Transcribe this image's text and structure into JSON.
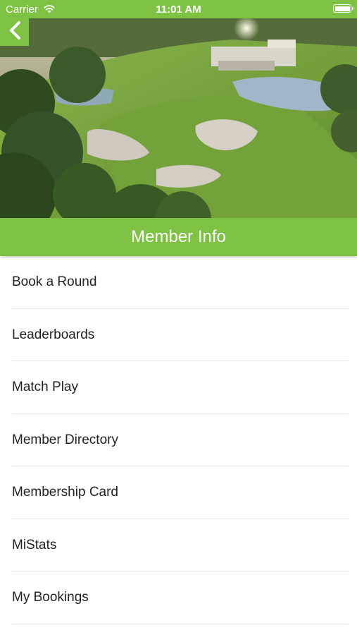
{
  "status_bar": {
    "carrier": "Carrier",
    "time": "11:01 AM",
    "wifi_icon": "wifi-icon",
    "battery_icon": "battery-icon"
  },
  "nav": {
    "back_icon": "chevron-left-icon"
  },
  "hero": {
    "image_subject": "aerial view of golf course with bunkers, lake and clubhouse"
  },
  "header": {
    "title": "Member Info"
  },
  "menu": {
    "items": [
      {
        "label": "Book a Round"
      },
      {
        "label": "Leaderboards"
      },
      {
        "label": "Match Play"
      },
      {
        "label": "Member Directory"
      },
      {
        "label": "Membership Card"
      },
      {
        "label": "MiStats"
      },
      {
        "label": "My Bookings"
      }
    ]
  },
  "colors": {
    "accent": "#7dc242",
    "text": "#222222",
    "divider": "#e6e6e6"
  }
}
